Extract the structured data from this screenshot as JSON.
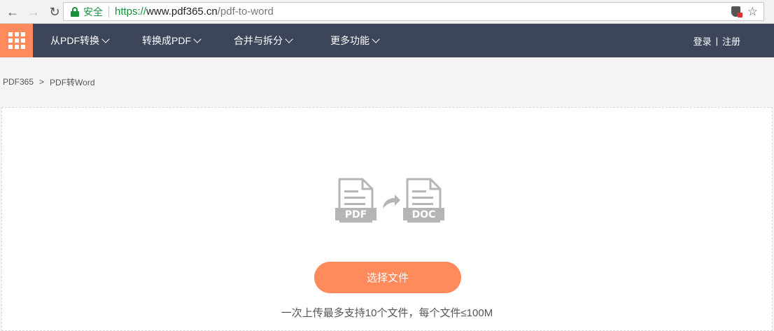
{
  "browser": {
    "secure_label": "安全",
    "url_scheme": "https://",
    "url_host": "www.pdf365.cn",
    "url_path": "/pdf-to-word"
  },
  "nav": {
    "items": [
      {
        "label": "从PDF转换"
      },
      {
        "label": "转换成PDF"
      },
      {
        "label": "合并与拆分"
      },
      {
        "label": "更多功能"
      }
    ],
    "login": "登录",
    "divider": "|",
    "register": "注册"
  },
  "breadcrumb": {
    "home": "PDF365",
    "separator": ">",
    "current": "PDF转Word"
  },
  "upload": {
    "from_label": "PDF",
    "to_label": "DOC",
    "button_label": "选择文件",
    "hint": "一次上传最多支持10个文件，每个文件≤100M"
  },
  "colors": {
    "accent": "#ff8a5b",
    "nav_bg": "#3c4559",
    "icon_gray": "#b5b5b5"
  }
}
